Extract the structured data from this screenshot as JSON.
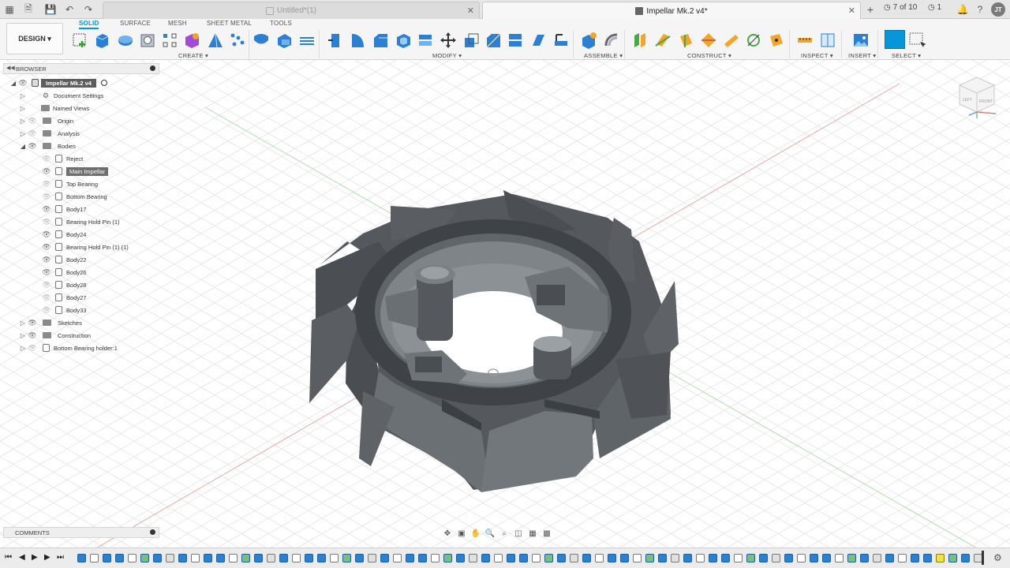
{
  "tabs": [
    {
      "title": "Untitled*(1)",
      "active": false
    },
    {
      "title": "Impellar Mk.2 v4*",
      "active": true
    }
  ],
  "tab_counter": "7 of 10",
  "job_status": "1",
  "user_initials": "JT",
  "workspace_button": "DESIGN ▾",
  "workspace_tabs": [
    "SOLID",
    "SURFACE",
    "MESH",
    "SHEET METAL",
    "TOOLS"
  ],
  "toolbar_groups": {
    "create": "CREATE ▾",
    "modify": "MODIFY ▾",
    "assemble": "ASSEMBLE ▾",
    "construct": "CONSTRUCT ▾",
    "inspect": "INSPECT ▾",
    "insert": "INSERT ▾",
    "select": "SELECT ▾"
  },
  "browser": {
    "title": "BROWSER",
    "root": "Impellar Mk.2 v4",
    "items": [
      {
        "label": "Document Settings"
      },
      {
        "label": "Named Views"
      },
      {
        "label": "Origin"
      },
      {
        "label": "Analysis"
      },
      {
        "label": "Bodies"
      },
      {
        "label": "Reject"
      },
      {
        "label": "Main Impellar"
      },
      {
        "label": "Top Bearing"
      },
      {
        "label": "Bottom Bearing"
      },
      {
        "label": "Body17"
      },
      {
        "label": "Bearing Hold Pin (1)"
      },
      {
        "label": "Body24"
      },
      {
        "label": "Bearing Hold Pin (1) (1)"
      },
      {
        "label": "Body22"
      },
      {
        "label": "Body26"
      },
      {
        "label": "Body28"
      },
      {
        "label": "Body27"
      },
      {
        "label": "Body33"
      },
      {
        "label": "Sketches"
      },
      {
        "label": "Construction"
      },
      {
        "label": "Bottom Bearing holder:1"
      }
    ]
  },
  "comments_title": "COMMENTS",
  "viewcube": {
    "left": "LEFT",
    "front": "FRONT"
  },
  "colors": {
    "accent": "#0696d7",
    "model": "#4b4f53",
    "grid": "#d9d9d9",
    "axis_red": "#e58a8a",
    "axis_green": "#8fcf8f"
  }
}
